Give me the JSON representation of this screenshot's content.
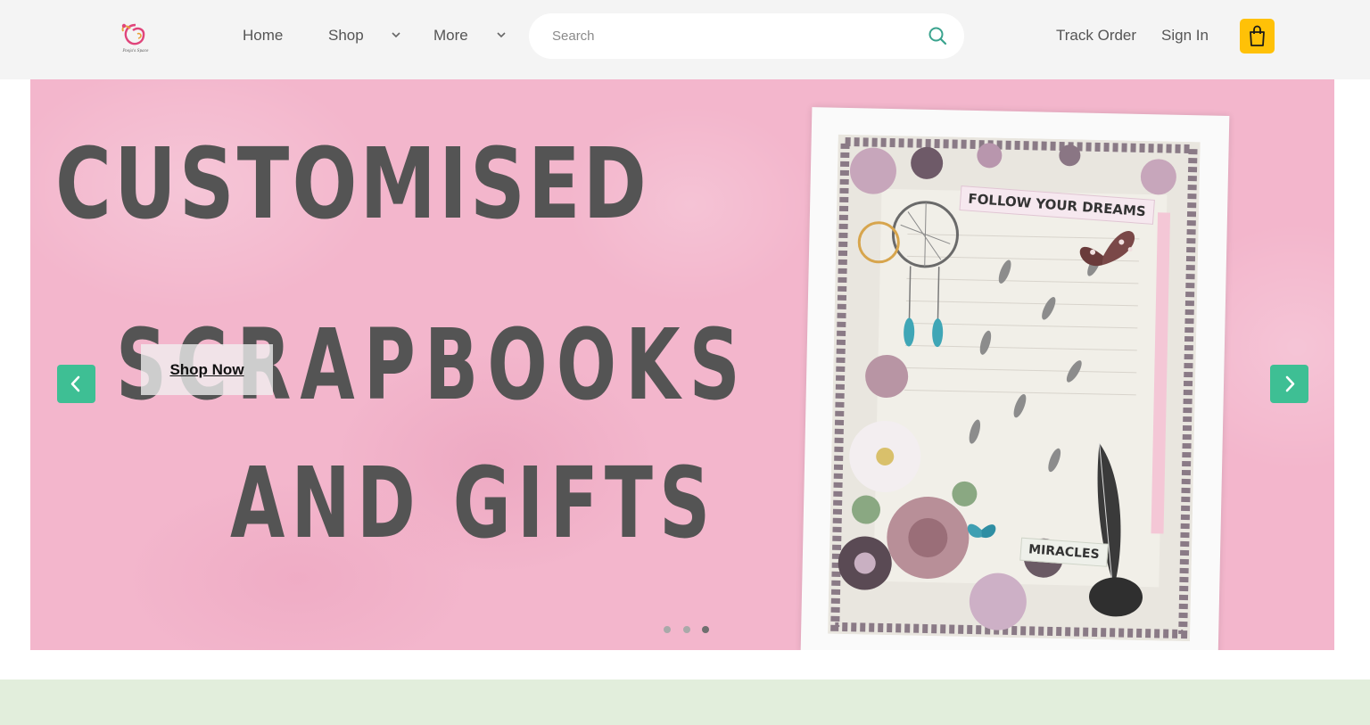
{
  "header": {
    "logo_text": "Pooja's Space",
    "nav": {
      "home": "Home",
      "shop": "Shop",
      "more": "More"
    },
    "search": {
      "placeholder": "Search",
      "value": ""
    },
    "track_order": "Track Order",
    "sign_in": "Sign In"
  },
  "hero": {
    "headline_line1": "CUSTOMISED",
    "headline_line2": "SCRAPBOOKS",
    "headline_line3": "AND GIFTS",
    "cta_label": "Shop Now",
    "card_label_top": "FOLLOW YOUR DREAMS",
    "card_label_bottom": "MIRACLES",
    "slides": {
      "count": 3,
      "active": 2
    }
  },
  "colors": {
    "header_bg": "#f4f4f4",
    "hero_bg": "#f3b6cc",
    "accent_teal": "#3ebf94",
    "cart_yellow": "#ffc107",
    "band_green": "#e2eedc",
    "search_icon": "#3aa38e"
  },
  "icons": {
    "logo": "brand-logo",
    "search": "search-icon",
    "cart": "shopping-bag-icon",
    "dropdown": "chevron-down-icon",
    "prev": "chevron-left-icon",
    "next": "chevron-right-icon"
  }
}
